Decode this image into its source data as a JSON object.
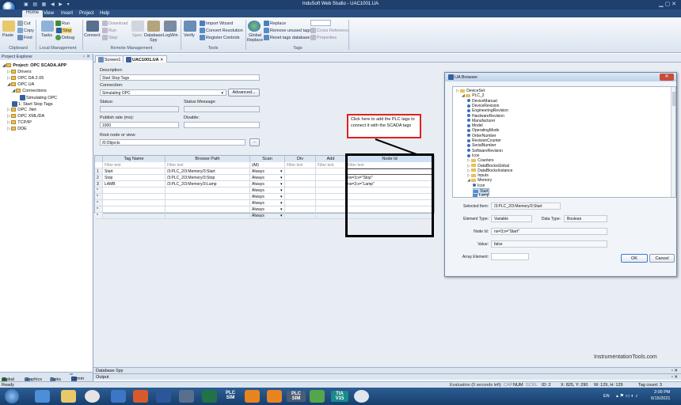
{
  "window": {
    "title": "InduSoft Web Studio - UAC1001.UA",
    "quick_access": "▣ ▤ ▦ ◀ ▶ ▾"
  },
  "menu": [
    "Home",
    "View",
    "Insert",
    "Project",
    "Help"
  ],
  "ribbon": {
    "clipboard": {
      "paste": "Paste",
      "cut": "Cut",
      "copy": "Copy",
      "find": "Find",
      "group": "Clipboard"
    },
    "local_mgmt": {
      "tasks": "Tasks",
      "run": "Run",
      "stop": "Stop",
      "debug": "Debug",
      "group": "Local Management"
    },
    "remote_mgmt": {
      "connect": "Connect",
      "download": "Download",
      "run": "Run",
      "stop": "Stop",
      "spec": "Spec",
      "database_spy": "Database\nSpy",
      "logwin": "LogWin",
      "group": "Remote Management"
    },
    "tools": {
      "verify": "Verify",
      "import_wizard": "Import Wizard",
      "convert_resolution": "Convert Resolution",
      "register_controls": "Register Controls",
      "group": "Tools"
    },
    "tags": {
      "global_replace": "Global\nReplace",
      "replace": "Replace",
      "remove_unused": "Remove unused tags",
      "cross_reference": "Cross Reference",
      "reset_tags_db": "Reset tags database",
      "properties": "Properties",
      "group": "Tags"
    }
  },
  "explorer": {
    "title": "Project Explorer",
    "items": [
      {
        "label": "Project: OPC SCADA.APP",
        "level": 0
      },
      {
        "label": "Drivers",
        "level": 1
      },
      {
        "label": "OPC DA 2.05",
        "level": 1
      },
      {
        "label": "OPC UA",
        "level": 1
      },
      {
        "label": "Connections",
        "level": 2
      },
      {
        "label": "Simulating OPC",
        "level": 3
      },
      {
        "label": "1: Start Stop Tags",
        "level": 2
      },
      {
        "label": "OPC .Net",
        "level": 1
      },
      {
        "label": "OPC XML/DA",
        "level": 1
      },
      {
        "label": "TCP/IP",
        "level": 1
      },
      {
        "label": "DDE",
        "level": 1
      }
    ],
    "tabs": [
      "Global",
      "Graphics",
      "Tasks",
      "Comm"
    ]
  },
  "doc_tabs": [
    "Screen1",
    "UAC1001.UA"
  ],
  "form": {
    "description_label": "Description:",
    "description": "Start Stop Tags",
    "connection_label": "Connection:",
    "connection": "Simulating OPC",
    "advanced": "Advanced...",
    "status_label": "Status:",
    "status_message_label": "Status Message:",
    "publish_rate_label": "Publish rate (ms):",
    "publish_rate": "1000",
    "disable_label": "Disable:",
    "root_node_label": "Root node or view:",
    "root_node": "/0:Objects",
    "browse": "..."
  },
  "grid": {
    "columns": [
      "Tag Name",
      "Browse Path",
      "Scan",
      "Div",
      "Add",
      "Node Id"
    ],
    "filter": "Filter text",
    "scan_filter": "(All)",
    "rows": [
      {
        "n": "1",
        "tag": "Start",
        "path": "/3:PLC_2/3:Memory/3:Start",
        "scan": "Always",
        "node": ""
      },
      {
        "n": "2",
        "tag": "Stop",
        "path": "/3:PLC_2/3:Memory/3:Stop",
        "scan": "Always",
        "node": "ns=3;s=\"Stop\""
      },
      {
        "n": "3",
        "tag": "LAMB",
        "path": "/3:PLC_2/3:Memory/3:Lamp",
        "scan": "Always",
        "node": "ns=3;s=\"Lamp\""
      },
      {
        "n": "*",
        "tag": "",
        "path": "",
        "scan": "Always",
        "node": ""
      },
      {
        "n": "*",
        "tag": "",
        "path": "",
        "scan": "Always",
        "node": ""
      },
      {
        "n": "*",
        "tag": "",
        "path": "",
        "scan": "Always",
        "node": ""
      },
      {
        "n": "*",
        "tag": "",
        "path": "",
        "scan": "Always",
        "node": ""
      },
      {
        "n": "*",
        "tag": "",
        "path": "",
        "scan": "Always",
        "node": ""
      }
    ]
  },
  "callout": "Click here to add the PLC tags to connect it with the SCADA tags",
  "ua_browser": {
    "title": "UA Browser",
    "close": "✕",
    "tree": [
      {
        "label": "DeviceSet",
        "level": 0,
        "kind": "folder"
      },
      {
        "label": "PLC_2",
        "level": 1,
        "kind": "folder"
      },
      {
        "label": "DeviceManual",
        "level": 2,
        "kind": "prop"
      },
      {
        "label": "DeviceRevision",
        "level": 2,
        "kind": "prop"
      },
      {
        "label": "EngineeringRevision",
        "level": 2,
        "kind": "prop"
      },
      {
        "label": "HardwareRevision",
        "level": 2,
        "kind": "prop"
      },
      {
        "label": "Manufacturer",
        "level": 2,
        "kind": "prop"
      },
      {
        "label": "Model",
        "level": 2,
        "kind": "prop"
      },
      {
        "label": "OperatingMode",
        "level": 2,
        "kind": "prop"
      },
      {
        "label": "OrderNumber",
        "level": 2,
        "kind": "prop"
      },
      {
        "label": "RevisionCounter",
        "level": 2,
        "kind": "prop"
      },
      {
        "label": "SerialNumber",
        "level": 2,
        "kind": "prop"
      },
      {
        "label": "SoftwareRevision",
        "level": 2,
        "kind": "prop"
      },
      {
        "label": "Icon",
        "level": 2,
        "kind": "prop"
      },
      {
        "label": "Counters",
        "level": 2,
        "kind": "folder"
      },
      {
        "label": "DataBlocksGlobal",
        "level": 2,
        "kind": "folder"
      },
      {
        "label": "DataBlocksInstance",
        "level": 2,
        "kind": "folder"
      },
      {
        "label": "Inputs",
        "level": 2,
        "kind": "folder"
      },
      {
        "label": "Memory",
        "level": 2,
        "kind": "folder"
      },
      {
        "label": "Icon",
        "level": 3,
        "kind": "prop"
      },
      {
        "label": "Start",
        "level": 3,
        "kind": "var"
      },
      {
        "label": "Lamp",
        "level": 3,
        "kind": "var"
      }
    ],
    "selected_item_label": "Selected Item:",
    "selected_item": "/3:PLC_2/3:Memory/3:Start",
    "element_type_label": "Element Type:",
    "element_type": "Variable",
    "data_type_label": "Data Type:",
    "data_type": "Boolean",
    "node_id_label": "Node Id:",
    "node_id": "ns=3;s=\"Start\"",
    "value_label": "Value:",
    "value": "false",
    "array_element_label": "Array Element:",
    "ok": "OK",
    "cancel": "Cancel"
  },
  "watermark": "InstrumentationTools.com",
  "panels": {
    "database_spy": "Database Spy",
    "output": "Output"
  },
  "status": {
    "left": "Ready",
    "eval": "Evaluation (0 seconds left)",
    "caps": "CAP",
    "num": "NUM",
    "scrl": "SCRL",
    "id": "ID: 2",
    "xy": "X: 825, Y: 290",
    "wh": "W: 129, H: 129",
    "tag": "Tag count: 3"
  },
  "taskbar": {
    "time": "2:00 PM",
    "date": "6/15/2021",
    "lang": "EN",
    "plcsim1": "PLC\nSIM",
    "plcsim2": "PLC\nSIM",
    "tia": "TIA\nV15"
  }
}
